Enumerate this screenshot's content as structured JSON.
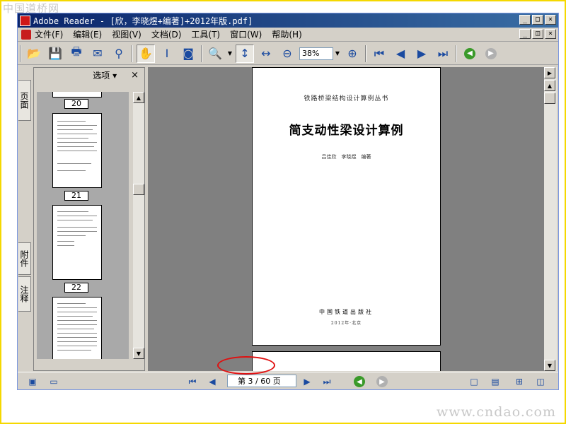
{
  "watermark": {
    "top": "中国道桥网",
    "bottom": "www.cndao.com"
  },
  "window": {
    "title": "Adobe Reader - [欣，李晓煜+编著]+2012年版.pdf]"
  },
  "menu": {
    "items": [
      "文件(F)",
      "编辑(E)",
      "视图(V)",
      "文档(D)",
      "工具(T)",
      "窗口(W)",
      "帮助(H)"
    ]
  },
  "toolbar": {
    "zoom_value": "38%"
  },
  "navigation": {
    "tabs": [
      "页面",
      "附件",
      "注释"
    ],
    "options_label": "选项 ▾",
    "close_label": "×",
    "thumbnails": [
      {
        "page": "20"
      },
      {
        "page": "21"
      },
      {
        "page": "22"
      }
    ]
  },
  "document": {
    "series": "铁路桥梁结构设计算例丛书",
    "title": "简支动性梁设计算例",
    "authors": "吕佳欣　李晓煜　编著",
    "publisher": "中国铁道出版社",
    "year_place": "2012年·北京"
  },
  "status": {
    "page_indicator": "第 3 / 60 页"
  },
  "colors": {
    "title_bar": "#0a246a",
    "frame": "#f5d800",
    "highlight_ellipse": "#e01010"
  }
}
